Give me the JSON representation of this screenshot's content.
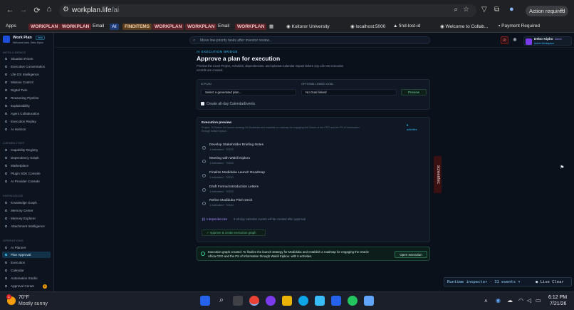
{
  "browser": {
    "back": "←",
    "forward": "→",
    "reload": "⟳",
    "home": "⌂",
    "url_host": "workplan.life",
    "url_path": "/ai",
    "zoom_icon": "⌕",
    "star_icon": "☆",
    "ext_icon": "▽",
    "puzzle_icon": "⧉",
    "profile_icon": "●",
    "action_badge": "Action required",
    "menu": "»",
    "bookmarks": [
      {
        "label": "Apps"
      },
      {
        "label": "WORKPLAN"
      },
      {
        "label": "WORKPLAN"
      },
      {
        "label": "Email"
      },
      {
        "label": "AI"
      },
      {
        "label": "FINDITEMS"
      },
      {
        "label": "WORKPLAN"
      },
      {
        "label": "WORKPLAN"
      },
      {
        "label": "Email"
      },
      {
        "label": "WORKPLAN"
      },
      {
        "label": "Koitoror University"
      },
      {
        "label": "localhost:5000"
      },
      {
        "label": "find-lost-id"
      },
      {
        "label": "Welcome to Collab..."
      },
      {
        "label": "Payment Required"
      }
    ]
  },
  "app": {
    "brand": "Work Plan",
    "brand_tag": "beta",
    "brand_sub": "Welcome back, Debo Kipko",
    "command_placeholder": "Move low-priority tasks after investor review...",
    "user_name": "Debo Kipko",
    "user_badge": "Admin",
    "user_sub": "Active Workspace",
    "sidebar": {
      "sections": [
        {
          "title": "INTELLIGENCE",
          "items": [
            "Situation Room",
            "Executive Conversation",
            "Life OS Intelligence",
            "Mission Control",
            "Digital Twin",
            "Reasoning Pipeline",
            "Explainability",
            "Agent Collaboration",
            "Execution Replay",
            "AI Horizon"
          ]
        },
        {
          "title": "CAPABILITIES",
          "items": [
            "Capability Registry",
            "Dependency Graph",
            "Marketplace",
            "Plugin SDK Console",
            "AI Provider Console"
          ]
        },
        {
          "title": "KNOWLEDGE",
          "items": [
            "Knowledge Graph",
            "Memory Center",
            "Memory Explorer",
            "Attachment Intelligence"
          ]
        },
        {
          "title": "OPERATIONS",
          "items": [
            "AI Planner",
            "Plan Approval",
            "Execution",
            "Calendar",
            "Automation Studio",
            "Approval Center"
          ]
        }
      ],
      "approval_count": "8"
    },
    "main": {
      "eyebrow": "AI EXECUTION BRIDGE",
      "title": "Approve a plan for execution",
      "desc_line1": "Preview the exact Project, Activities, dependencies, and optional Calendar impact before any Life OS execution",
      "desc_line2": "records are created.",
      "ai_plan_label": "AI PLAN",
      "ai_plan_value": "Select a generated plan...",
      "goal_label": "OPTIONAL LINKED GOAL",
      "goal_value": "No Goal linked",
      "preview_btn": "Preview",
      "calendar_check": "Create all-day CalendarEvents",
      "exec_title": "Execution preview",
      "exec_desc_line1": "Project: To finalize the launch strategy for Modiduka and establish a roadmap for engaging the Oracle of the CEO and the PS of Information",
      "exec_desc_line2": "through Wakili Kipkoo.",
      "activity_count": "5",
      "activity_word": "activities",
      "tasks": [
        {
          "title": "Develop Stakeholder Briefing Notes",
          "sub": "1 estimated · TODO"
        },
        {
          "title": "Meeting with Wakili Kipkoo",
          "sub": "1 estimated · TODO"
        },
        {
          "title": "Finalize Modiduka Launch Roadmap",
          "sub": "1 estimated · TODO"
        },
        {
          "title": "Draft Formal Introduction Letters",
          "sub": "1 estimated · TODO"
        },
        {
          "title": "Refine Modiduka Pitch Deck",
          "sub": "1 estimated · TODO"
        }
      ],
      "deps": "4 dependencies",
      "cal_note": "5 all-day calendar events will be created after approval",
      "approve_btn": "Approve & create execution graph",
      "success_line1": "Execution graph created: To finalize the launch strategy for Modiduka and establish a roadmap for engaging the Oracle",
      "success_line2": "Africa CEO and the PS of Information through Wakili Kipkoo. with 5 activities.",
      "open_btn": "Open execution",
      "inspector": "Runtime inspector · 31 events ▾",
      "live": "● Live Clear",
      "side_tab": "screentec"
    }
  },
  "taskbar": {
    "weather_temp": "70°F",
    "weather_desc": "Mostly sunny",
    "time": "6:12 PM",
    "date": "7/21/26",
    "notif": "1"
  }
}
